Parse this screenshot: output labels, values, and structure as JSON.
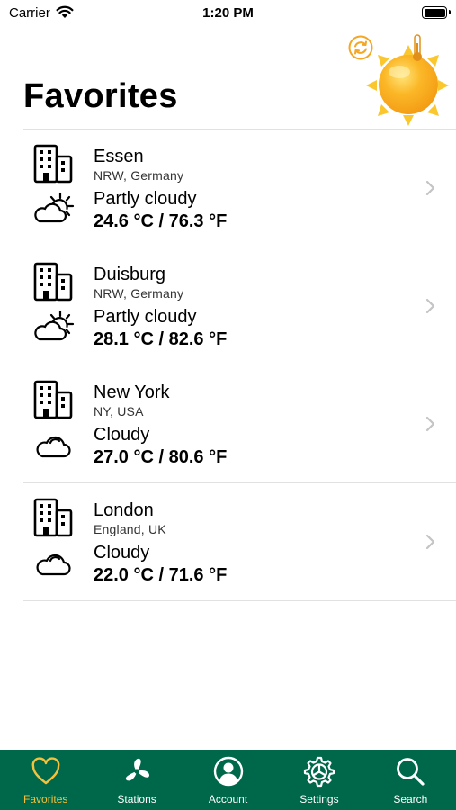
{
  "status_bar": {
    "carrier": "Carrier",
    "time": "1:20 PM"
  },
  "header": {
    "title": "Favorites"
  },
  "favorites": [
    {
      "city": "Essen",
      "region": "NRW, Germany",
      "condition": "Partly cloudy",
      "temps": "24.6 °C / 76.3 °F",
      "weather_icon": "partly-cloudy-icon"
    },
    {
      "city": "Duisburg",
      "region": "NRW, Germany",
      "condition": "Partly cloudy",
      "temps": "28.1 °C / 82.6 °F",
      "weather_icon": "partly-cloudy-icon"
    },
    {
      "city": "New York",
      "region": "NY, USA",
      "condition": "Cloudy",
      "temps": "27.0 °C / 80.6 °F",
      "weather_icon": "cloudy-icon"
    },
    {
      "city": "London",
      "region": "England, UK",
      "condition": "Cloudy",
      "temps": "22.0 °C / 71.6 °F",
      "weather_icon": "cloudy-icon"
    }
  ],
  "tab_bar": {
    "background": "#00684a",
    "active_color": "#f5c13c",
    "inactive_color": "#ffffff",
    "tabs": [
      {
        "label": "Favorites",
        "icon": "heart-icon",
        "active": true
      },
      {
        "label": "Stations",
        "icon": "fan-icon",
        "active": false
      },
      {
        "label": "Account",
        "icon": "account-icon",
        "active": false
      },
      {
        "label": "Settings",
        "icon": "gear-icon",
        "active": false
      },
      {
        "label": "Search",
        "icon": "search-icon",
        "active": false
      }
    ]
  },
  "colors": {
    "accent": "#f5a623",
    "divider": "#e1e1e1",
    "chevron": "#c4c4c7"
  }
}
